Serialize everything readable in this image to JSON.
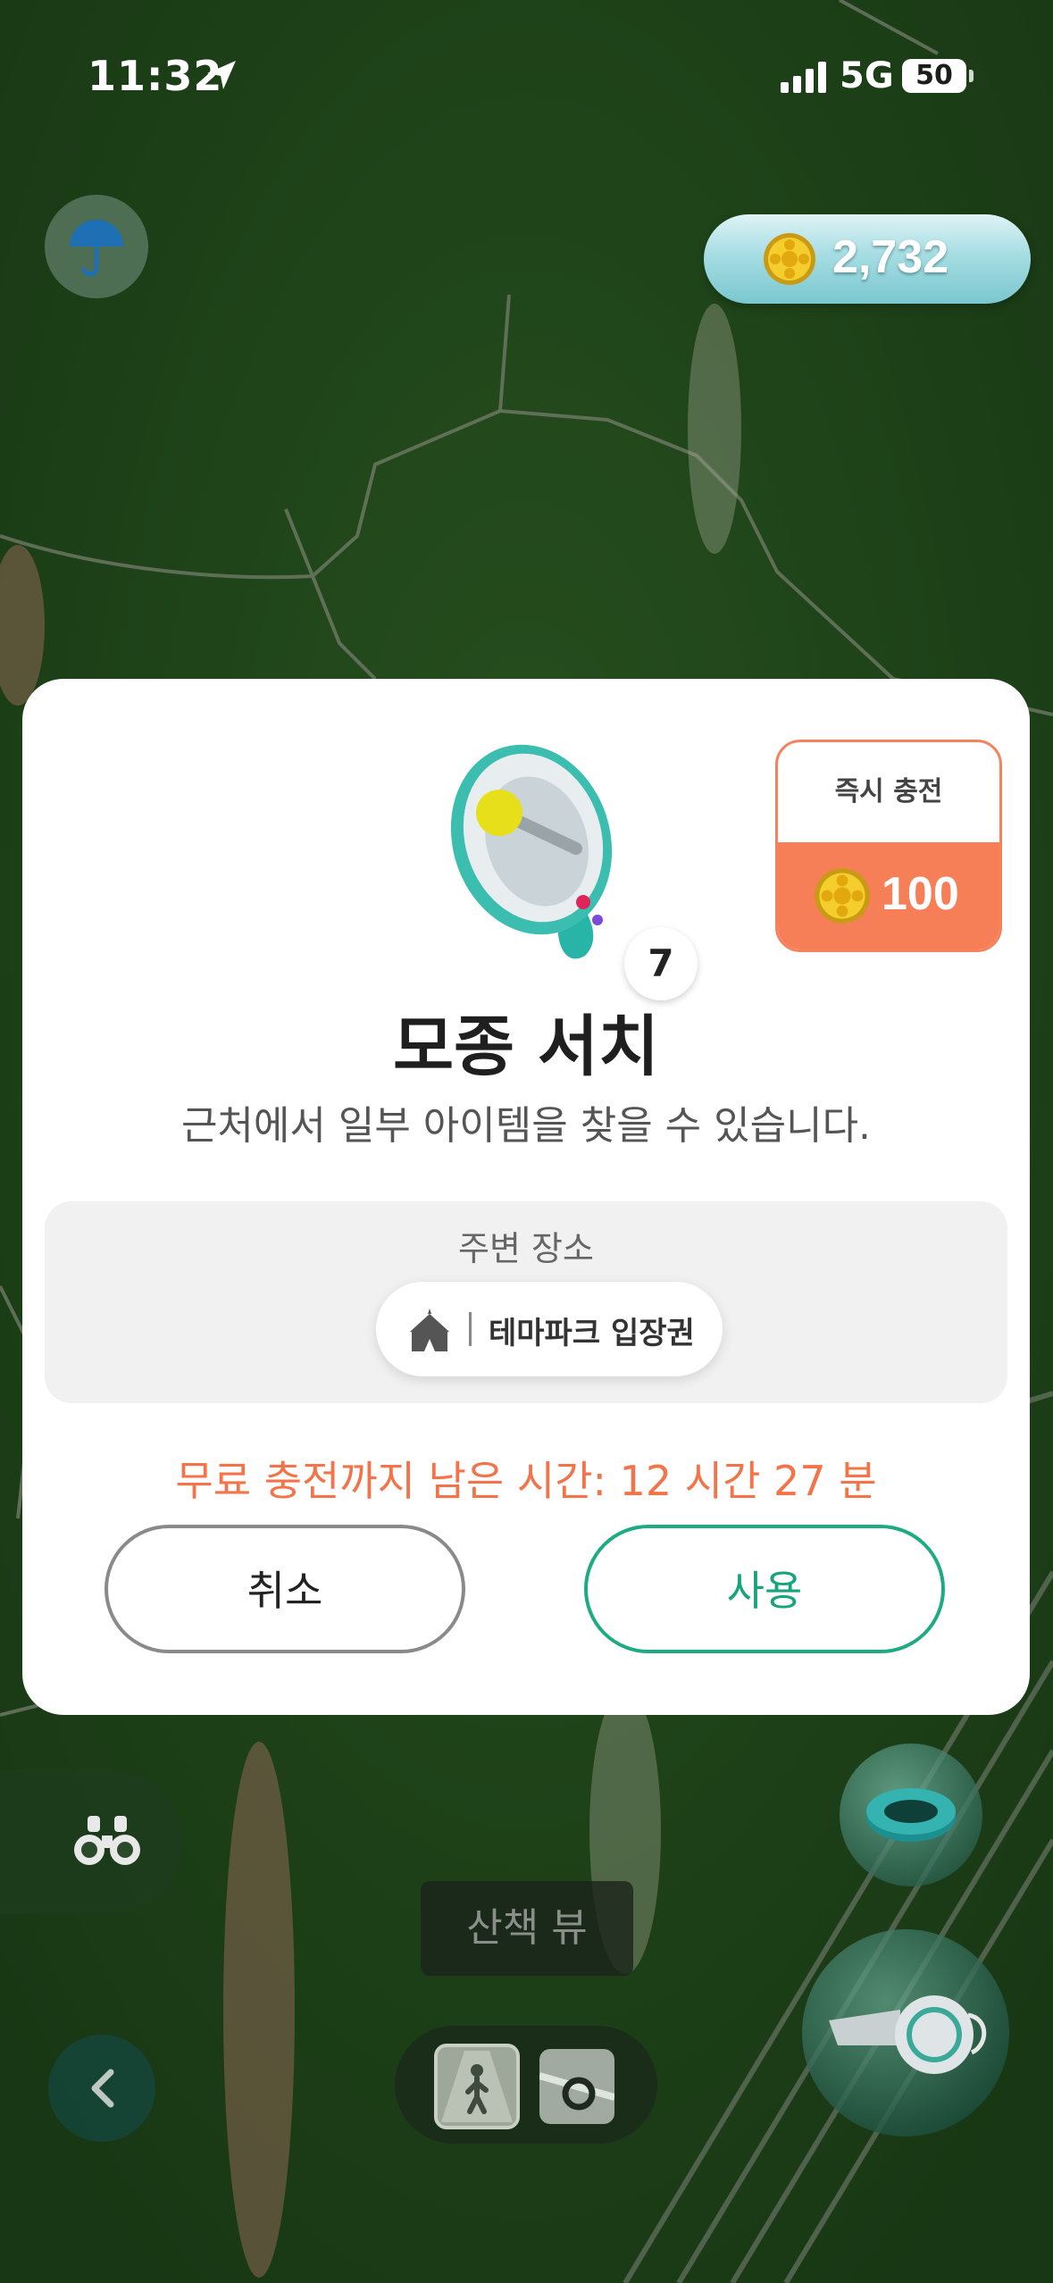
{
  "status_bar": {
    "time": "11:32",
    "network": "5G",
    "battery": "50"
  },
  "top_bar": {
    "coin_balance": "2,732"
  },
  "modal": {
    "item_name": "모종 서치",
    "item_count": "7",
    "description": "근처에서 일부 아이템을 찾을 수 있습니다.",
    "instant_charge": {
      "label": "즉시 충전",
      "price": "100"
    },
    "nearby": {
      "heading": "주변 장소",
      "place": "테마파크 입장권"
    },
    "timer_text": "무료 충전까지 남은 시간: 12 시간 27 분",
    "cancel_label": "취소",
    "use_label": "사용"
  },
  "bottom": {
    "walk_view_label": "산책 뷰"
  },
  "colors": {
    "accent_orange": "#f77f58",
    "accent_green": "#1eab84",
    "map_green": "#254f1e"
  }
}
